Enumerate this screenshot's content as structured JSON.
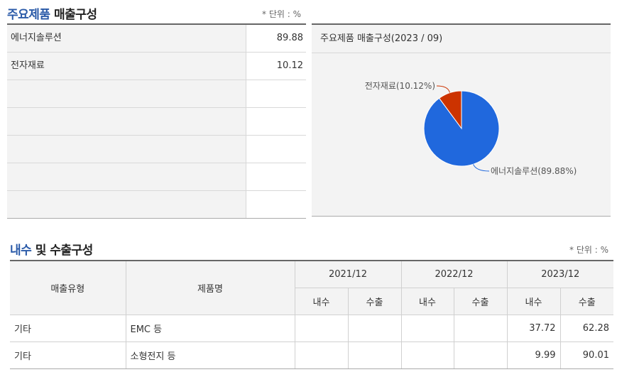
{
  "main_products": {
    "title_highlight": "주요제품",
    "title_rest": "매출구성",
    "unit": "* 단위 : %",
    "rows": [
      {
        "name": "에너지솔루션",
        "value": "89.88"
      },
      {
        "name": "전자재료",
        "value": "10.12"
      },
      {
        "name": "",
        "value": ""
      },
      {
        "name": "",
        "value": ""
      },
      {
        "name": "",
        "value": ""
      },
      {
        "name": "",
        "value": ""
      },
      {
        "name": "",
        "value": ""
      }
    ]
  },
  "chart_panel": {
    "title": "주요제품 매출구성(2023 / 09)"
  },
  "chart_data": {
    "type": "pie",
    "slices": [
      {
        "label": "에너지솔루션(89.88%)",
        "value": 89.88,
        "color": "#2068dd"
      },
      {
        "label": "전자재료(10.12%)",
        "value": 10.12,
        "color": "#cc3300"
      }
    ]
  },
  "domestic_export": {
    "title_highlight": "내수",
    "title_rest": "및 수출구성",
    "unit": "* 단위 : %",
    "headers": {
      "sales_type": "매출유형",
      "product": "제품명",
      "years": [
        "2021/12",
        "2022/12",
        "2023/12"
      ],
      "domestic": "내수",
      "export": "수출"
    },
    "rows": [
      {
        "type": "기타",
        "product": "EMC 등",
        "values": [
          "",
          "",
          "",
          "",
          "37.72",
          "62.28"
        ]
      },
      {
        "type": "기타",
        "product": "소형전지 등",
        "values": [
          "",
          "",
          "",
          "",
          "9.99",
          "90.01"
        ]
      }
    ]
  }
}
